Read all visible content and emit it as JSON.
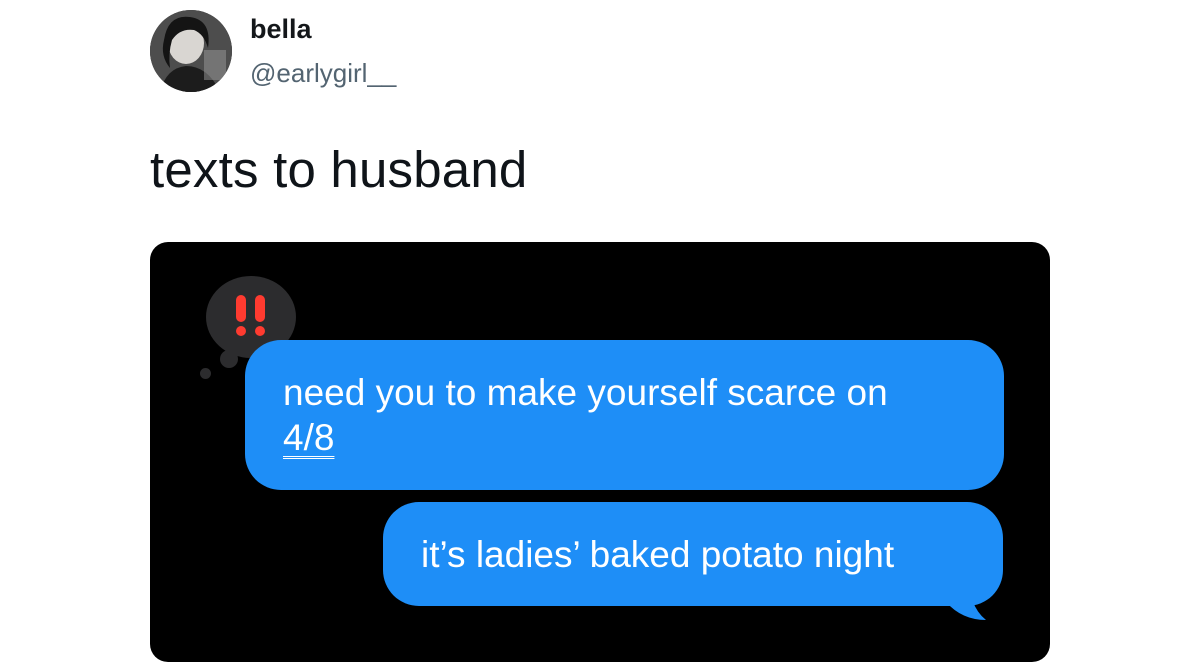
{
  "tweet": {
    "display_name": "bella",
    "handle": "@earlygirl__",
    "text": "texts to husband"
  },
  "conversation": {
    "tapback": {
      "icon": "double-exclamation-icon",
      "glyph": "‼",
      "color": "#ff3b30"
    },
    "messages": [
      {
        "text_before_link": "need you to make yourself scarce on",
        "link_text": "4/8"
      },
      {
        "text": "it’s ladies’ baked potato night"
      }
    ]
  },
  "colors": {
    "bubble": "#1e8ef7",
    "media_background": "#000000",
    "tapback_background": "#2c2c2e"
  }
}
